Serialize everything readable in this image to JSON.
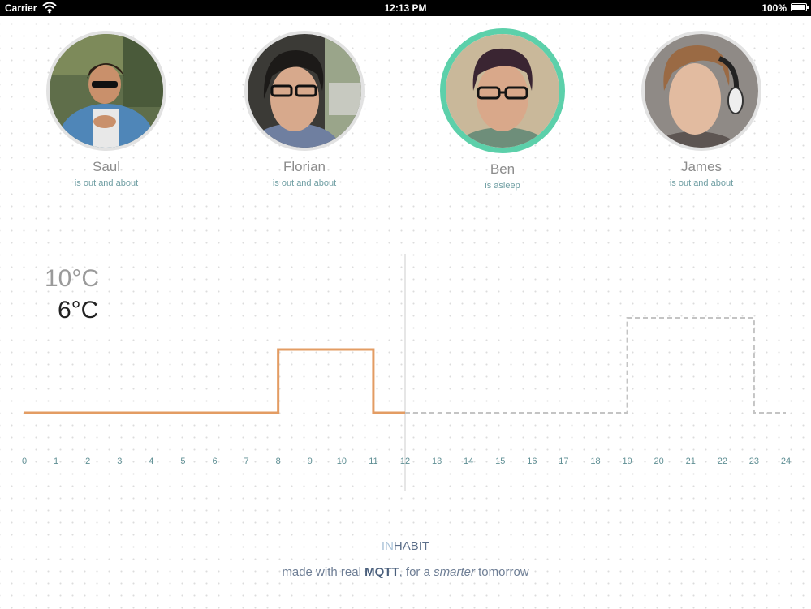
{
  "status_bar": {
    "carrier": "Carrier",
    "time": "12:13 PM",
    "battery": "100%"
  },
  "people": [
    {
      "name": "Saul",
      "status": "is out and about",
      "active": false
    },
    {
      "name": "Florian",
      "status": "is out and about",
      "active": false
    },
    {
      "name": "Ben",
      "status": "is asleep",
      "active": true
    },
    {
      "name": "James",
      "status": "is out and about",
      "active": false
    }
  ],
  "temperature": {
    "target": "10°C",
    "current": "6°C"
  },
  "chart_data": {
    "type": "line",
    "x_ticks": [
      "0",
      "1",
      "2",
      "3",
      "4",
      "5",
      "6",
      "7",
      "8",
      "9",
      "10",
      "11",
      "12",
      "13",
      "14",
      "15",
      "16",
      "17",
      "18",
      "19",
      "20",
      "21",
      "22",
      "23",
      "24"
    ],
    "xlim": [
      0,
      24
    ],
    "now_hour": 12,
    "series": [
      {
        "style": "solid",
        "color": "#e39c63",
        "points": [
          [
            0,
            0
          ],
          [
            8,
            0
          ],
          [
            8,
            1
          ],
          [
            11,
            1
          ],
          [
            11,
            0
          ],
          [
            12,
            0
          ]
        ]
      },
      {
        "style": "dashed",
        "color": "#c4c4c4",
        "points": [
          [
            12,
            0
          ],
          [
            19,
            0
          ],
          [
            19,
            1.5
          ],
          [
            23,
            1.5
          ],
          [
            23,
            0
          ],
          [
            24,
            0
          ]
        ]
      }
    ]
  },
  "footer": {
    "brand_in": "IN",
    "brand_habit": "HABIT",
    "tagline_pre": "made with real ",
    "tagline_bold": "MQTT",
    "tagline_mid": ", for a ",
    "tagline_italic": "smarter",
    "tagline_post": " tomorrow"
  },
  "colors": {
    "accent": "#5cd0aa",
    "heating_line": "#e39c63",
    "schedule_line": "#c4c4c4"
  }
}
